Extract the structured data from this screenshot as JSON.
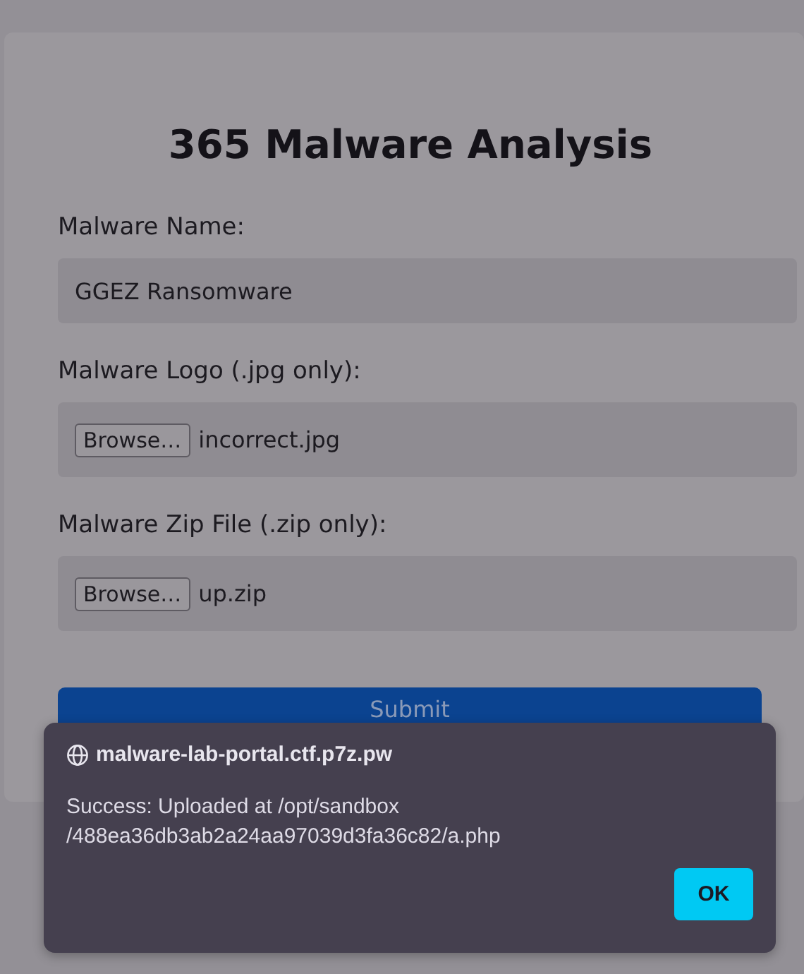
{
  "page": {
    "title": "365 Malware Analysis",
    "fields": [
      {
        "kind": "text",
        "label": "Malware Name:",
        "value": "GGEZ Ransomware"
      },
      {
        "kind": "file",
        "label": "Malware Logo (.jpg only):",
        "button": "Browse…",
        "value": "incorrect.jpg"
      },
      {
        "kind": "file",
        "label": "Malware Zip File (.zip only):",
        "button": "Browse…",
        "value": "up.zip"
      }
    ],
    "submit": "Submit"
  },
  "dialog": {
    "origin": "malware-lab-portal.ctf.p7z.pw",
    "message": "Success: Uploaded at /opt/sandbox\n/488ea36db3ab2a24aa97039d3fa36c82/a.php",
    "button": "OK"
  }
}
